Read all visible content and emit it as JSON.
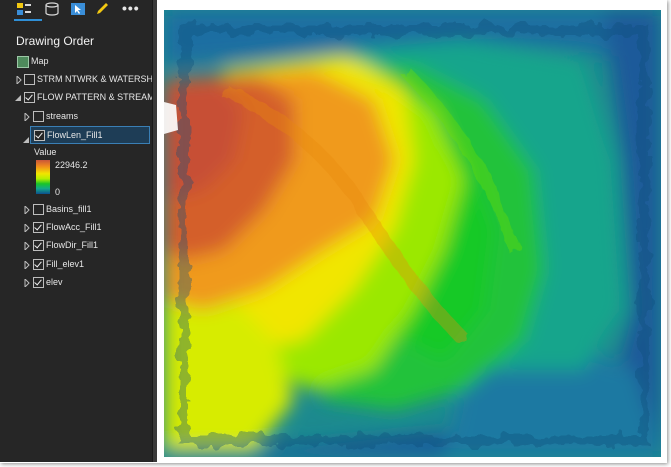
{
  "contents_pane": {
    "title": "Drawing Order",
    "toolbar_icons": [
      "list-by-drawing-order-icon",
      "list-by-source-icon",
      "list-by-selection-icon",
      "list-by-editing-icon",
      "more-options-icon"
    ],
    "more_label": "•••"
  },
  "tree": {
    "map": {
      "label": "Map",
      "icon": "map-icon"
    },
    "layers": [
      {
        "label": "STRM NTWRK & WATERSHE",
        "checked": false,
        "expanded": false,
        "group": true
      },
      {
        "label": "FLOW PATTERN & STREAMS",
        "checked": true,
        "expanded": true,
        "group": true
      },
      {
        "label": "streams",
        "checked": false,
        "expanded": false
      },
      {
        "label": "FlowLen_Fill1",
        "checked": true,
        "expanded": true,
        "selected": true
      },
      {
        "label": "Basins_fill1",
        "checked": false,
        "expanded": false
      },
      {
        "label": "FlowAcc_Fill1",
        "checked": true,
        "expanded": false
      },
      {
        "label": "FlowDir_Fill1",
        "checked": true,
        "expanded": false
      },
      {
        "label": "Fill_elev1",
        "checked": true,
        "expanded": false
      },
      {
        "label": "elev",
        "checked": true,
        "expanded": false
      }
    ]
  },
  "legend": {
    "title": "Value",
    "high": "22946.2",
    "low": "0",
    "ramp_colors": [
      "#c8553a",
      "#f08a1e",
      "#f2e500",
      "#b6ef00",
      "#19c429",
      "#12a88a",
      "#0d4f8e"
    ]
  },
  "colors": {
    "pane_background": "#262626",
    "selection": "#1e3d56",
    "accent": "#2f8fd6"
  }
}
